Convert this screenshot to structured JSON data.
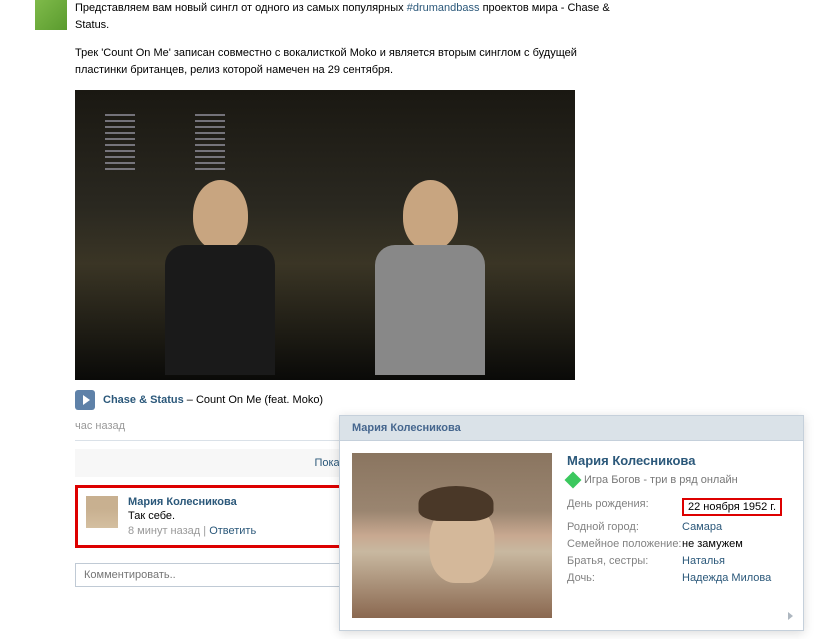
{
  "post": {
    "text_part1": "Представляем вам новый сингл от одного из самых популярных ",
    "hashtag": "#drumandbass",
    "text_part2": " проектов мира - Chase & Status.",
    "text_block2": "Трек 'Count On Me' записан совместно с вокалисткой Moko и является вторым синглом с будущей пластинки британцев, релиз которой намечен на 29 сентября.",
    "track_artist": "Chase & Status",
    "track_separator": " – ",
    "track_title": "Count On Me (feat. Moko)",
    "time": "час назад",
    "show_all": "Показать вс"
  },
  "comment": {
    "author": "Мария Колесникова",
    "text": "Так себе.",
    "time": "8 минут назад",
    "meta_sep": " | ",
    "reply": "Ответить",
    "input_placeholder": "Комментировать.."
  },
  "popup": {
    "header": "Мария Колесникова",
    "name": "Мария Колесникова",
    "status": "Игра Богов - три в ряд онлайн",
    "rows": [
      {
        "label": "День рождения:",
        "value": "22 ноября 1952 г.",
        "boxed": true,
        "link": false
      },
      {
        "label": "Родной город:",
        "value": "Самара",
        "link": true
      },
      {
        "label": "Семейное положение:",
        "value": "не замужем",
        "link": false
      },
      {
        "label": "Братья, сестры:",
        "value": "Наталья",
        "link": true
      },
      {
        "label": "Дочь:",
        "value": "Надежда Милова",
        "link": true
      }
    ]
  }
}
